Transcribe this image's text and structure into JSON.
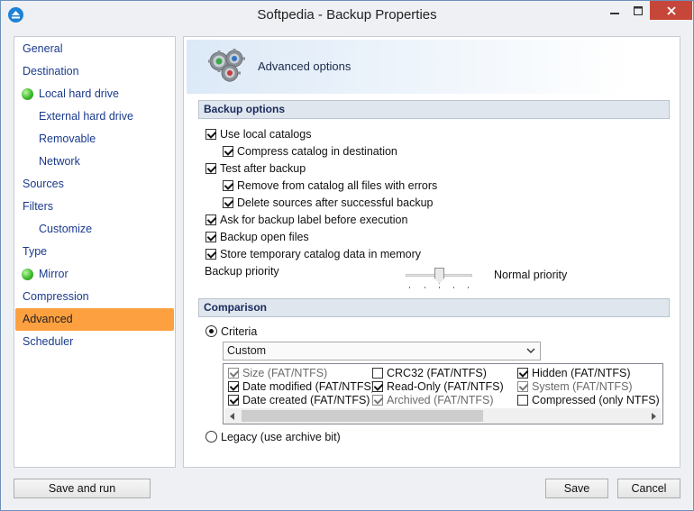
{
  "window": {
    "title": "Softpedia - Backup Properties",
    "app_icon": "eject-icon"
  },
  "nav": {
    "items": [
      {
        "label": "General",
        "level": 0,
        "active": false,
        "indicator": false
      },
      {
        "label": "Destination",
        "level": 0,
        "active": false,
        "indicator": false
      },
      {
        "label": "Local hard drive",
        "level": 1,
        "active": false,
        "indicator": true
      },
      {
        "label": "External hard drive",
        "level": 1,
        "active": false,
        "indicator": false
      },
      {
        "label": "Removable",
        "level": 1,
        "active": false,
        "indicator": false
      },
      {
        "label": "Network",
        "level": 1,
        "active": false,
        "indicator": false
      },
      {
        "label": "Sources",
        "level": 0,
        "active": false,
        "indicator": false
      },
      {
        "label": "Filters",
        "level": 0,
        "active": false,
        "indicator": false
      },
      {
        "label": "Customize",
        "level": 1,
        "active": false,
        "indicator": false
      },
      {
        "label": "Type",
        "level": 0,
        "active": false,
        "indicator": false
      },
      {
        "label": "Mirror",
        "level": 1,
        "active": false,
        "indicator": true
      },
      {
        "label": "Compression",
        "level": 0,
        "active": false,
        "indicator": false
      },
      {
        "label": "Advanced",
        "level": 0,
        "active": true,
        "indicator": false
      },
      {
        "label": "Scheduler",
        "level": 0,
        "active": false,
        "indicator": false
      }
    ]
  },
  "content": {
    "header_title": "Advanced options",
    "header_icon": "gears-icon",
    "backup_options": {
      "title": "Backup options",
      "options": [
        {
          "label": "Use local catalogs",
          "checked": true
        },
        {
          "label": "Compress catalog in destination",
          "checked": true
        },
        {
          "label": "Test after backup",
          "checked": true
        },
        {
          "label": "Remove from catalog all files with errors",
          "checked": true
        },
        {
          "label": "Delete sources after successful backup",
          "checked": true
        },
        {
          "label": "Ask for backup label before execution",
          "checked": true
        },
        {
          "label": "Backup open files",
          "checked": true
        },
        {
          "label": "Store temporary catalog data in memory",
          "checked": true
        }
      ],
      "priority_label": "Backup priority",
      "priority_value_label": "Normal priority",
      "priority_level": 0.5
    },
    "comparison": {
      "title": "Comparison",
      "criteria_label": "Criteria",
      "criteria_selected": true,
      "criteria_value": "Custom",
      "legacy_label": "Legacy (use archive bit)",
      "legacy_selected": false,
      "attributes": [
        {
          "label": "Size (FAT/NTFS)",
          "checked": true,
          "disabled": true
        },
        {
          "label": "CRC32 (FAT/NTFS)",
          "checked": false,
          "disabled": false
        },
        {
          "label": "Hidden (FAT/NTFS)",
          "checked": true,
          "disabled": false
        },
        {
          "label": "Date modified (FAT/NTFS)",
          "checked": true,
          "disabled": false
        },
        {
          "label": "Read-Only (FAT/NTFS)",
          "checked": true,
          "disabled": false
        },
        {
          "label": "System (FAT/NTFS)",
          "checked": true,
          "disabled": true
        },
        {
          "label": "Date created (FAT/NTFS)",
          "checked": true,
          "disabled": false
        },
        {
          "label": "Archived (FAT/NTFS)",
          "checked": true,
          "disabled": true
        },
        {
          "label": "Compressed (only NTFS)",
          "checked": false,
          "disabled": false
        }
      ]
    }
  },
  "buttons": {
    "save_and_run": "Save and run",
    "save": "Save",
    "cancel": "Cancel"
  }
}
